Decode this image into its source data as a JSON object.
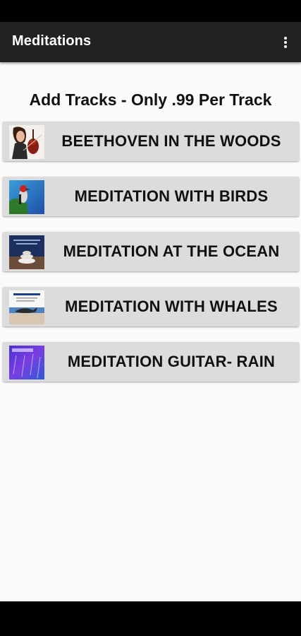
{
  "app_bar": {
    "title": "Meditations",
    "menu_icon": "more-vert-icon"
  },
  "header": {
    "text": "Add Tracks - Only .99 Per Track"
  },
  "tracks": [
    {
      "label": "BEETHOVEN IN THE WOODS",
      "thumb_icon": "violinist-thumbnail"
    },
    {
      "label": "MEDITATION WITH BIRDS",
      "thumb_icon": "bird-thumbnail"
    },
    {
      "label": "MEDITATION AT THE OCEAN",
      "thumb_icon": "ocean-stones-thumbnail"
    },
    {
      "label": "MEDITATION WITH WHALES",
      "thumb_icon": "whale-thumbnail"
    },
    {
      "label": "MEDITATION GUITAR- RAIN",
      "thumb_icon": "rain-thumbnail"
    }
  ]
}
